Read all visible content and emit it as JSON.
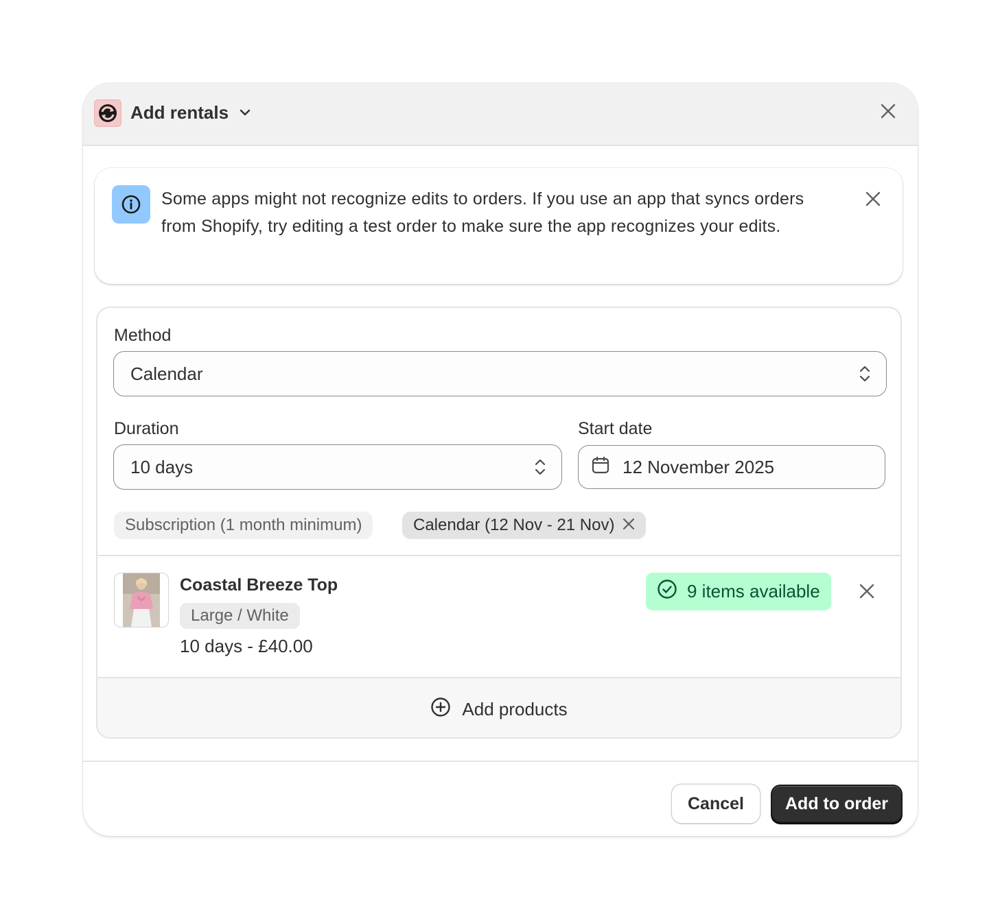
{
  "header": {
    "title": "Add rentals",
    "app_icon": "rentals-sync-icon",
    "close_icon": "close-icon"
  },
  "banner": {
    "text": "Some apps might not recognize edits to orders. If you use an app that syncs orders from Shopify, try editing a test order to make sure the app recognizes your edits.",
    "icon": "info-icon"
  },
  "form": {
    "method_label": "Method",
    "method_value": "Calendar",
    "duration_label": "Duration",
    "duration_value": "10 days",
    "start_date_label": "Start date",
    "start_date_value": "12 November 2025"
  },
  "tags": [
    {
      "label": "Subscription (1 month minimum)",
      "removable": false
    },
    {
      "label": "Calendar (12 Nov - 21 Nov)",
      "removable": true
    }
  ],
  "line_item": {
    "name": "Coastal Breeze Top",
    "variant": "Large / White",
    "price": "10 days - £40.00",
    "availability": "9 items available"
  },
  "add_products_label": "Add products",
  "footer": {
    "cancel_label": "Cancel",
    "submit_label": "Add to order"
  },
  "colors": {
    "availability_bg": "#b4fed2",
    "availability_text": "#0c5132",
    "info_icon_bg": "#91c9ff",
    "primary_button": "#303030"
  }
}
